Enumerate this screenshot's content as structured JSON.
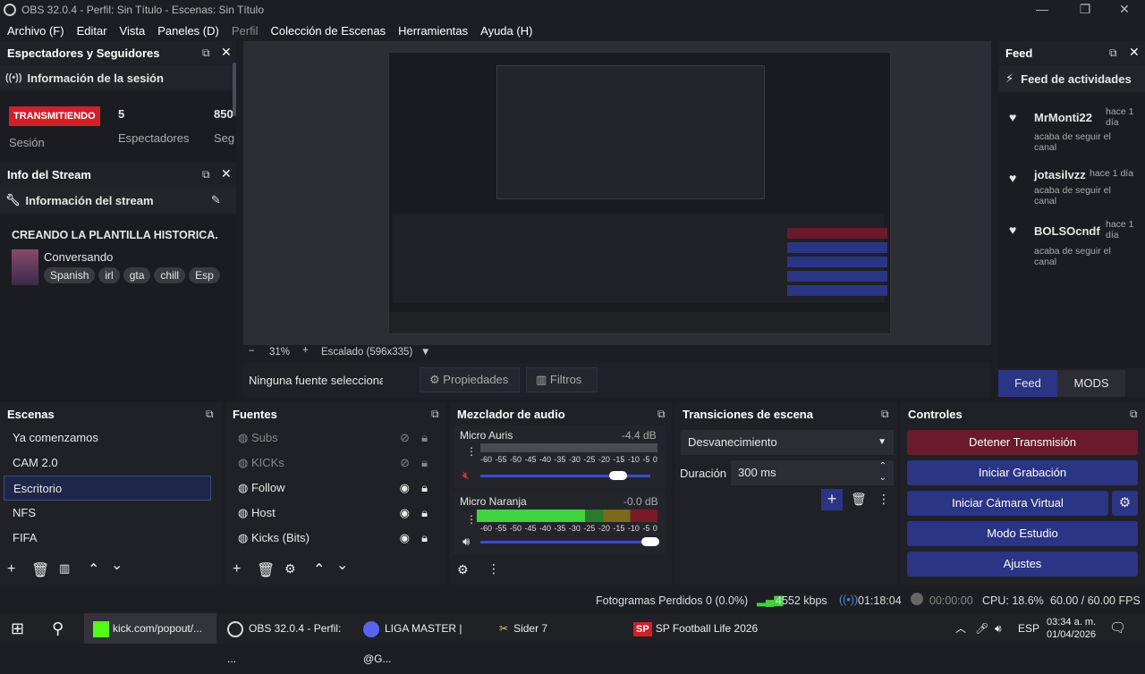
{
  "window": {
    "title": "OBS 32.0.4 - Perfil: Sin Título - Escenas: Sin Título",
    "min": "—",
    "max": "❐",
    "close": "✕"
  },
  "menu": [
    "Archivo (F)",
    "Editar",
    "Vista",
    "Paneles (D)",
    "Perfil",
    "Colección de Escenas",
    "Herramientas",
    "Ayuda (H)"
  ],
  "viewers": {
    "dock_title": "Espectadores y Seguidores",
    "section": "Información de la sesión",
    "live_badge": "TRANSMITIENDO",
    "session_label": "Sesión",
    "viewers_value": "5",
    "viewers_label": "Espectadores",
    "followers_value": "850",
    "followers_label": "Seg"
  },
  "stream_info": {
    "dock_title": "Info del Stream",
    "section": "Información del stream",
    "title": "CREANDO LA PLANTILLA HISTORICA.",
    "category": "Conversando",
    "tags": [
      "Spanish",
      "irl",
      "gta",
      "chill",
      "Esp"
    ]
  },
  "preview": {
    "zoom": "31%",
    "minus": "−",
    "plus": "+",
    "scale": "Escalado (596x335)",
    "no_source": "Ninguna fuente seleccionada",
    "properties": "Propiedades",
    "filters": "Filtros"
  },
  "feed": {
    "dock_title": "Feed",
    "section": "Feed de actividades",
    "items": [
      {
        "user": "MrMonti22",
        "time": "hace 1 día",
        "action": "acaba de seguir el canal"
      },
      {
        "user": "jotasilvzz",
        "time": "hace 1 día",
        "action": "acaba de seguir el canal"
      },
      {
        "user": "BOLSOcndf",
        "time": "hace 1 día",
        "action": "acaba de seguir el canal"
      }
    ],
    "tab_feed": "Feed",
    "tab_mods": "MODS"
  },
  "scenes": {
    "title": "Escenas",
    "items": [
      "Ya comenzamos",
      "CAM 2.0",
      "Escritorio",
      "NFS",
      "FIFA"
    ],
    "selected": 2
  },
  "sources": {
    "title": "Fuentes",
    "items": [
      {
        "name": "Subs",
        "visible": false
      },
      {
        "name": "KICKs",
        "visible": false
      },
      {
        "name": "Follow",
        "visible": true
      },
      {
        "name": "Host",
        "visible": true
      },
      {
        "name": "Kicks (Bits)",
        "visible": true
      }
    ]
  },
  "mixer": {
    "title": "Mezclador de audio",
    "ticks": [
      "-60",
      "-55",
      "-50",
      "-45",
      "-40",
      "-35",
      "-30",
      "-25",
      "-20",
      "-15",
      "-10",
      "-5",
      "0"
    ],
    "channels": [
      {
        "name": "Micro Auris",
        "db": "-4.4 dB",
        "muted": true,
        "level": 0.0,
        "volume": 1.0
      },
      {
        "name": "Micro Naranja",
        "db": "-0.0 dB",
        "muted": false,
        "level": 0.6,
        "volume": 1.0
      }
    ]
  },
  "transitions": {
    "title": "Transiciones de escena",
    "selected": "Desvanecimiento",
    "duration_label": "Duración",
    "duration": "300 ms"
  },
  "controls": {
    "title": "Controles",
    "stop_stream": "Detener Transmisión",
    "start_recording": "Iniciar Grabación",
    "virtual_cam": "Iniciar Cámara Virtual",
    "studio": "Modo Estudio",
    "settings": "Ajustes"
  },
  "status": {
    "dropped": "Fotogramas Perdidos 0 (0.0%)",
    "kbps": "4552 kbps",
    "stream_time": "01:18:04",
    "rec_time": "00:00:00",
    "cpu": "CPU: 18.6%",
    "fps": "60.00 / 60.00 FPS"
  },
  "taskbar": {
    "apps": [
      "kick.com/popout/...",
      "OBS 32.0.4 - Perfil: ...",
      "LIGA MASTER | @G...",
      "Sider 7",
      "SP Football Life 2026"
    ],
    "lang": "ESP",
    "time": "03:34 a. m.",
    "date": "01/04/2026"
  },
  "colors": {
    "accent": "#2a3585",
    "stop": "#6b1a2c",
    "live": "#e0202a",
    "meter_green": "#3fd43f",
    "meter_yellow": "#c8c42a",
    "meter_red": "#c4283a"
  }
}
